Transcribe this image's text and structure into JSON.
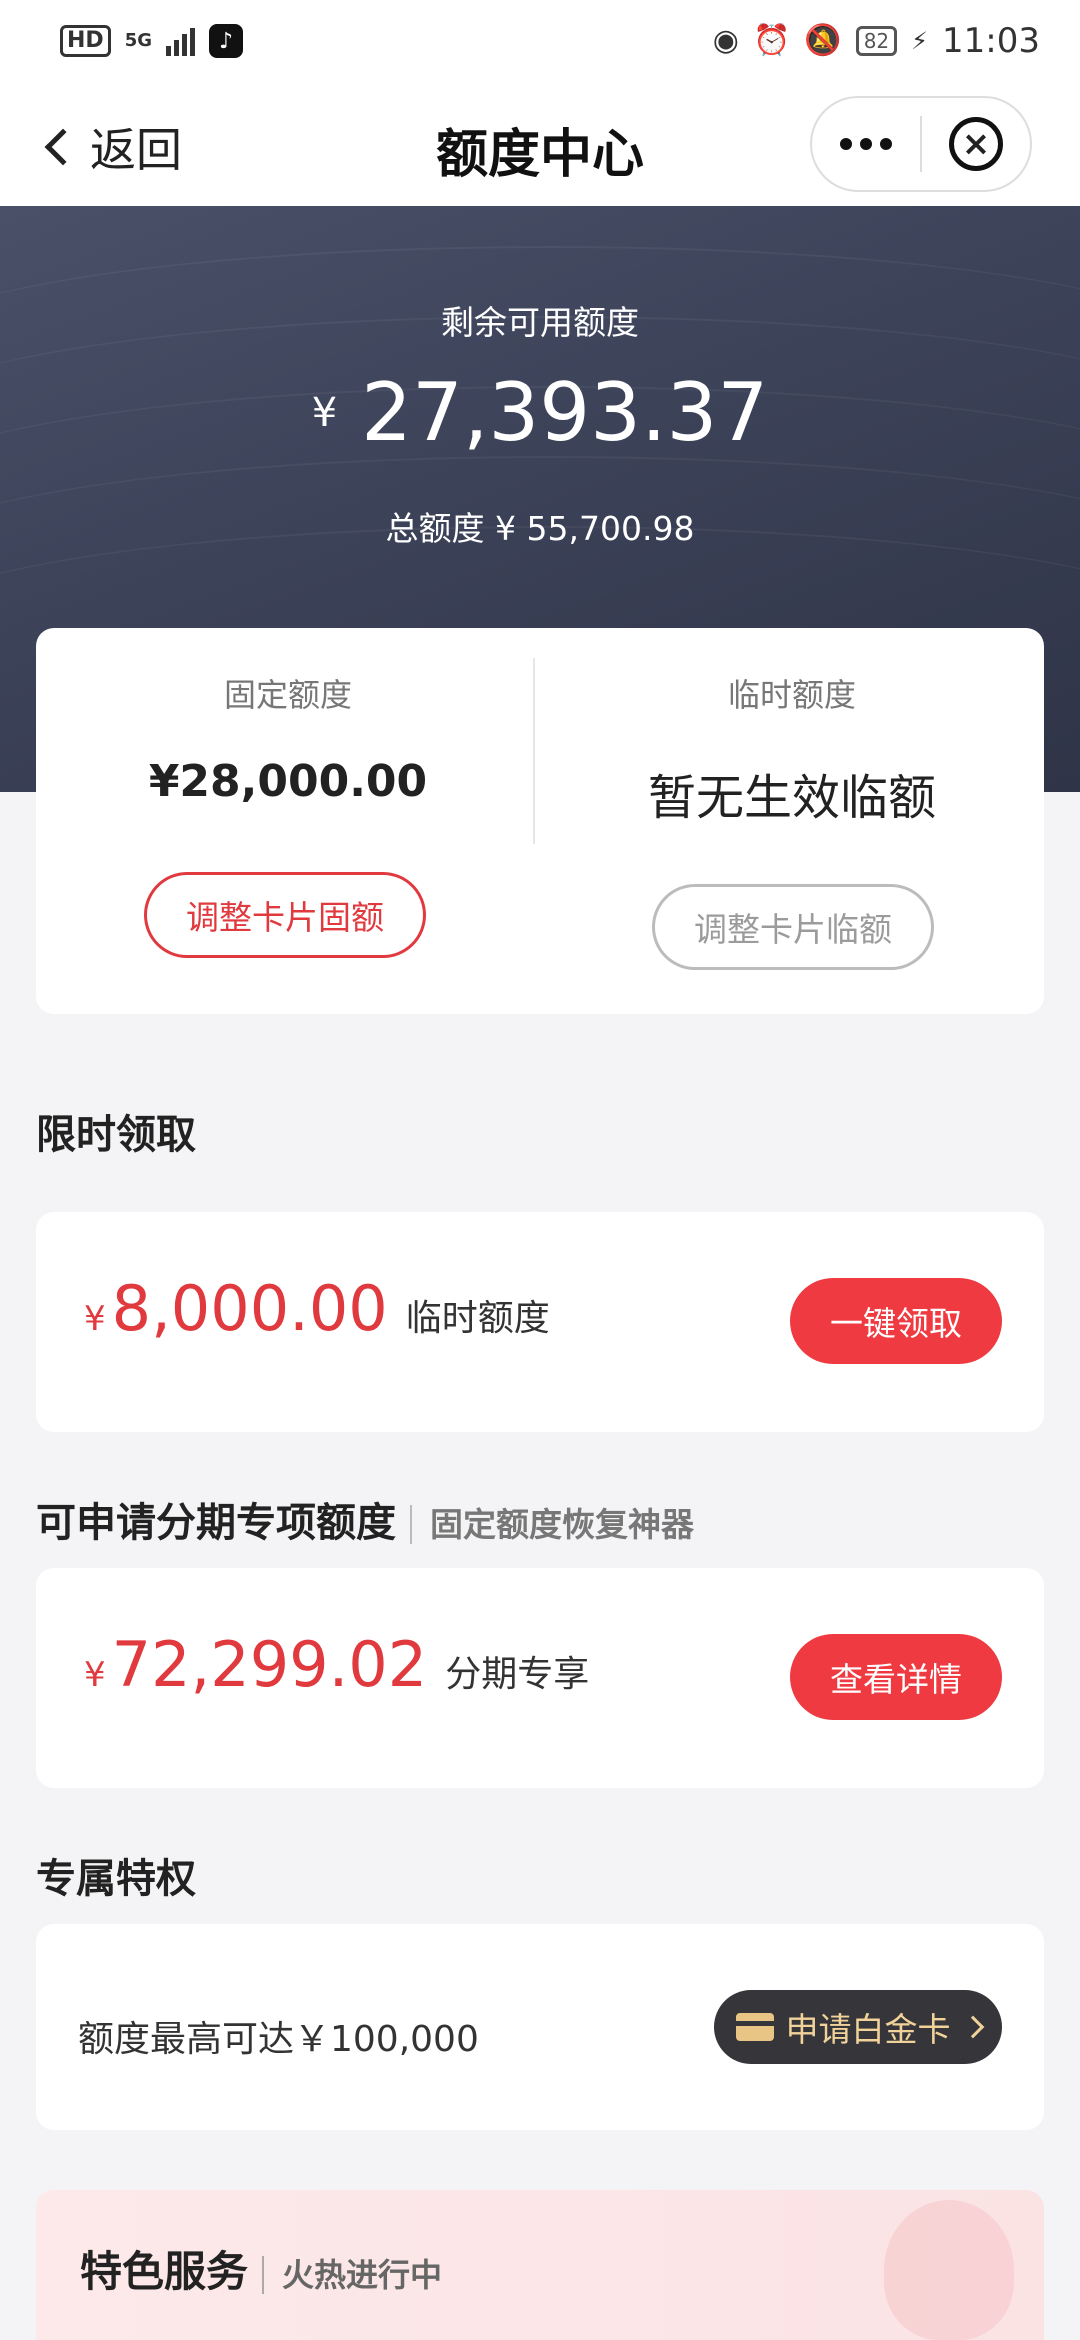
{
  "status_bar": {
    "hd": "HD",
    "network": "5G",
    "battery": "82",
    "time": "11:03"
  },
  "nav": {
    "back_label": "返回",
    "title": "额度中心"
  },
  "hero": {
    "label": "剩余可用额度",
    "currency": "¥",
    "available": "27,393.37",
    "total_label": "总额度",
    "total_value": "¥ 55,700.98"
  },
  "quota": {
    "fixed_title": "固定额度",
    "fixed_value": "¥28,000.00",
    "fixed_button": "调整卡片固额",
    "temp_title": "临时额度",
    "temp_value": "暂无生效临额",
    "temp_button": "调整卡片临额"
  },
  "limited": {
    "title": "限时领取",
    "currency": "¥",
    "amount": "8,000.00",
    "desc": "临时额度",
    "button": "一键领取"
  },
  "installment": {
    "title": "可申请分期专项额度",
    "subtitle": "固定额度恢复神器",
    "currency": "¥",
    "amount": "72,299.02",
    "desc": "分期专享",
    "button": "查看详情"
  },
  "privilege": {
    "title": "专属特权",
    "text": "额度最高可达￥100,000",
    "button": "申请白金卡"
  },
  "special": {
    "title": "特色服务",
    "subtitle": "火热进行中"
  },
  "colors": {
    "accent_red": "#ef3a41",
    "hero_bg": "#3c4258",
    "gold": "#f1d39a"
  }
}
